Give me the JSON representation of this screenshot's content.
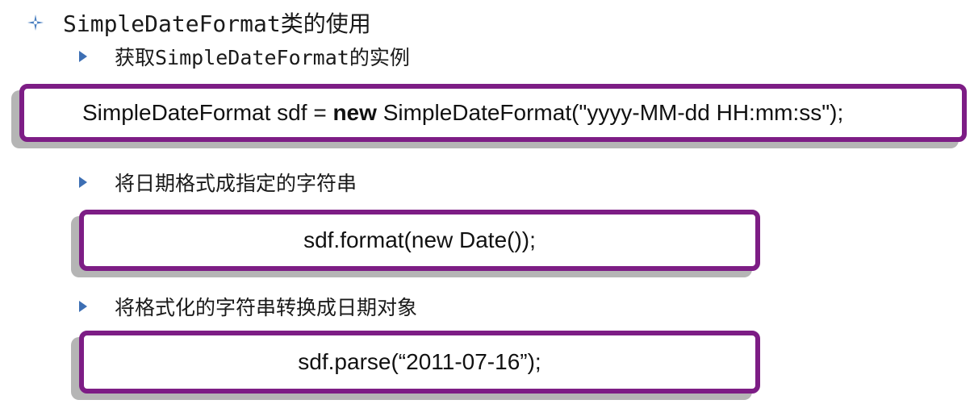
{
  "heading": {
    "icon": "four-pointed-star-icon",
    "text": "SimpleDateFormat类的使用"
  },
  "sections": [
    {
      "bullet_icon": "triangle-bullet-icon",
      "label": "获取SimpleDateFormat的实例",
      "code": {
        "before": "SimpleDateFormat sdf = ",
        "keyword": "new",
        "after": " SimpleDateFormat(\"yyyy-MM-dd HH:mm:ss\");"
      }
    },
    {
      "bullet_icon": "triangle-bullet-icon",
      "label": "将日期格式成指定的字符串",
      "code": {
        "text": "sdf.format(new Date());"
      }
    },
    {
      "bullet_icon": "triangle-bullet-icon",
      "label": "将格式化的字符串转换成日期对象",
      "code": {
        "text": "sdf.parse(“2011-07-16”);"
      }
    }
  ],
  "colors": {
    "box_border": "#7d1d85",
    "box_shadow": "#b5b5b5",
    "bullet": "#3d6fb4",
    "heading_icon": "#4a7fc0"
  }
}
